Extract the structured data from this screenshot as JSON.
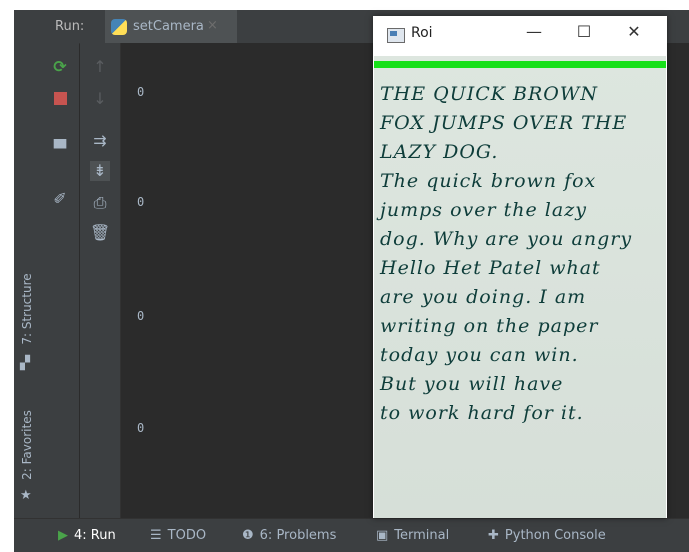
{
  "run_panel": {
    "label": "Run:",
    "tab_name": "setCamera",
    "tab_close": "×"
  },
  "side_tabs": [
    {
      "label": "7: Structure"
    },
    {
      "label": "2: Favorites"
    }
  ],
  "console": {
    "lines": [
      "0",
      "0",
      "0",
      "0"
    ]
  },
  "bottom_tabs": [
    {
      "label": "4: Run",
      "icon": "▶"
    },
    {
      "label": "TODO",
      "icon": "☰"
    },
    {
      "label": "6: Problems",
      "icon": "❶"
    },
    {
      "label": "Terminal",
      "icon": "▣"
    },
    {
      "label": "Python Console",
      "icon": "✚"
    }
  ],
  "roi_window": {
    "title": "Roi",
    "minimize": "—",
    "maximize": "☐",
    "close": "✕",
    "handwritten_lines": [
      "THE QUICK BROWN",
      "FOX JUMPS OVER THE",
      "LAZY DOG.",
      "The quick brown fox",
      "jumps over the lazy",
      "dog. Why are you angry",
      "Hello Het Patel what",
      "are you doing. I am",
      "writing on the paper",
      "today you can win.",
      "But you will have",
      "to work hard for it."
    ]
  },
  "colors": {
    "ide_bg": "#2b2b2b",
    "panel_bg": "#3c3f41",
    "accent": "#4a88c7",
    "rerun_green": "#4aa34a",
    "stop_red": "#c75450",
    "roi_green_bar": "#18e01a"
  }
}
